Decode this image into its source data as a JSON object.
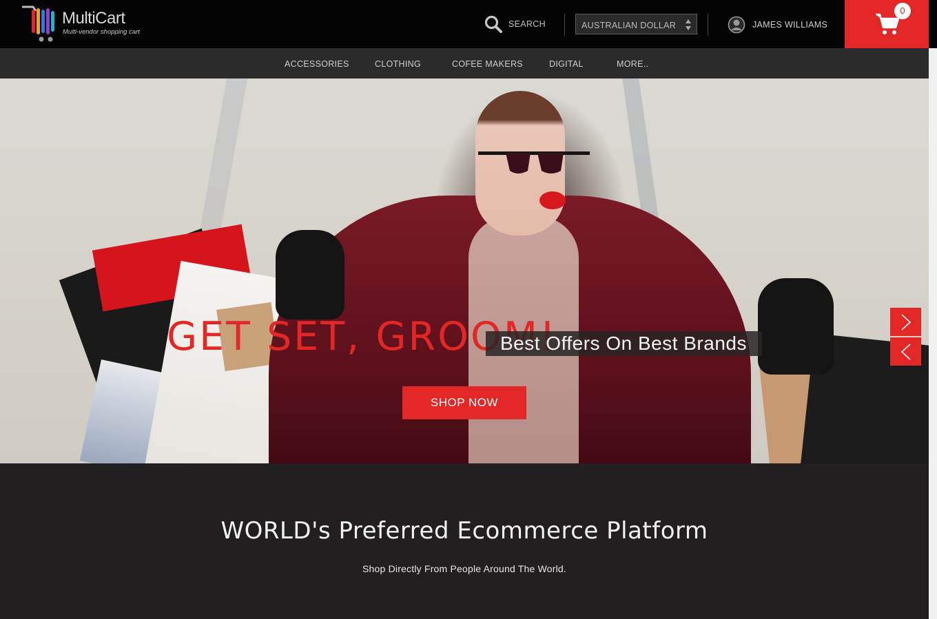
{
  "header": {
    "logo": {
      "name": "MultiCart",
      "tagline": "Multi-vendor shopping cart"
    },
    "search_label": "SEARCH",
    "currency_selected": "AUSTRALIAN DOLLAR",
    "user_name": "JAMES WILLIAMS",
    "cart_count": "0"
  },
  "nav": {
    "items": [
      "ACCESSORIES",
      "CLOTHING",
      "COFEE MAKERS",
      "DIGITAL",
      "MORE.."
    ]
  },
  "hero": {
    "headline": "GET SET, GROOM!",
    "tagline": "Best Offers On Best Brands",
    "cta_label": "SHOP NOW"
  },
  "promo": {
    "title": "WORLD's Preferred Ecommerce Platform",
    "subtitle": "Shop Directly From People Around The World."
  },
  "colors": {
    "accent": "#e32626",
    "header_bg": "#040404",
    "nav_bg": "#2b2b2b",
    "promo_bg": "#211f1f"
  },
  "icons": [
    "search-icon",
    "user-icon",
    "cart-icon",
    "chevron-right-icon",
    "chevron-left-icon",
    "select-arrows-icon"
  ]
}
